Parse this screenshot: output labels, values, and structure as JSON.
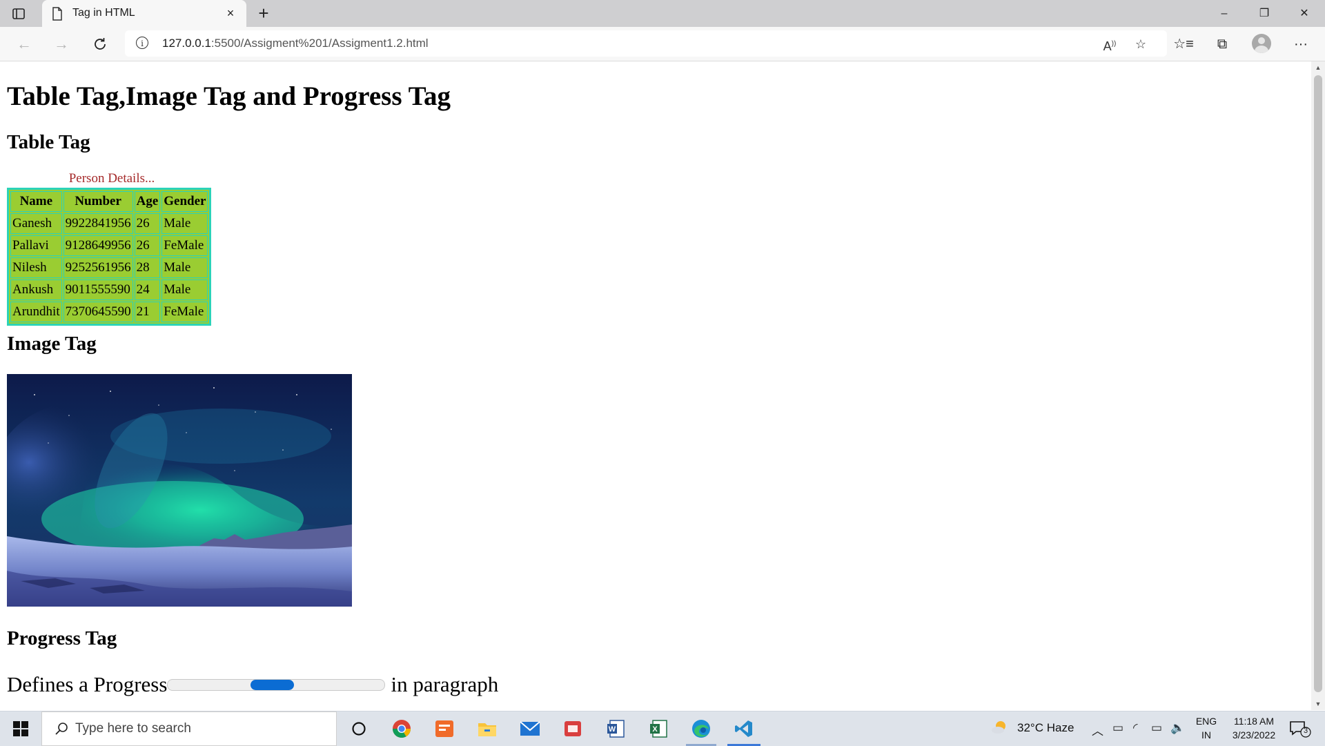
{
  "browser": {
    "tab_title": "Tag in HTML",
    "tab_close": "×",
    "new_tab": "+",
    "url_host": "127.0.0.1",
    "url_path": ":5500/Assigment%201/Assigment1.2.html",
    "window_controls": {
      "minimize": "–",
      "maximize": "❐",
      "close": "✕"
    }
  },
  "page": {
    "title": "Table Tag,Image Tag and Progress Tag",
    "table_heading": "Table Tag",
    "table_caption": "Person Details...",
    "table": {
      "headers": [
        "Name",
        "Number",
        "Age",
        "Gender"
      ],
      "rows": [
        [
          "Ganesh",
          "9922841956",
          "26",
          "Male"
        ],
        [
          "Pallavi",
          "9128649956",
          "26",
          "FeMale"
        ],
        [
          "Nilesh",
          "9252561956",
          "28",
          "Male"
        ],
        [
          "Ankush",
          "9011555590",
          "24",
          "Male"
        ],
        [
          "Arundhit",
          "7370645590",
          "21",
          "FeMale"
        ]
      ],
      "colors": {
        "background": "#9acd32",
        "border": "#2cd3b8",
        "caption": "#a52a2a"
      }
    },
    "image_heading": "Image Tag",
    "image_alt": "aurora-landscape",
    "progress_heading": "Progress Tag",
    "progress_text_before": "Defines a Progress",
    "progress_text_after": "in paragraph",
    "progress_state": "indeterminate"
  },
  "taskbar": {
    "search_placeholder": "Type here to search",
    "apps": [
      "cortana",
      "chrome",
      "task-app",
      "file-explorer",
      "mail",
      "office-app",
      "word",
      "excel",
      "edge",
      "vscode"
    ],
    "weather": "32°C  Haze",
    "language_top": "ENG",
    "language_bottom": "IN",
    "time": "11:18 AM",
    "date": "3/23/2022",
    "notification_count": "3"
  }
}
